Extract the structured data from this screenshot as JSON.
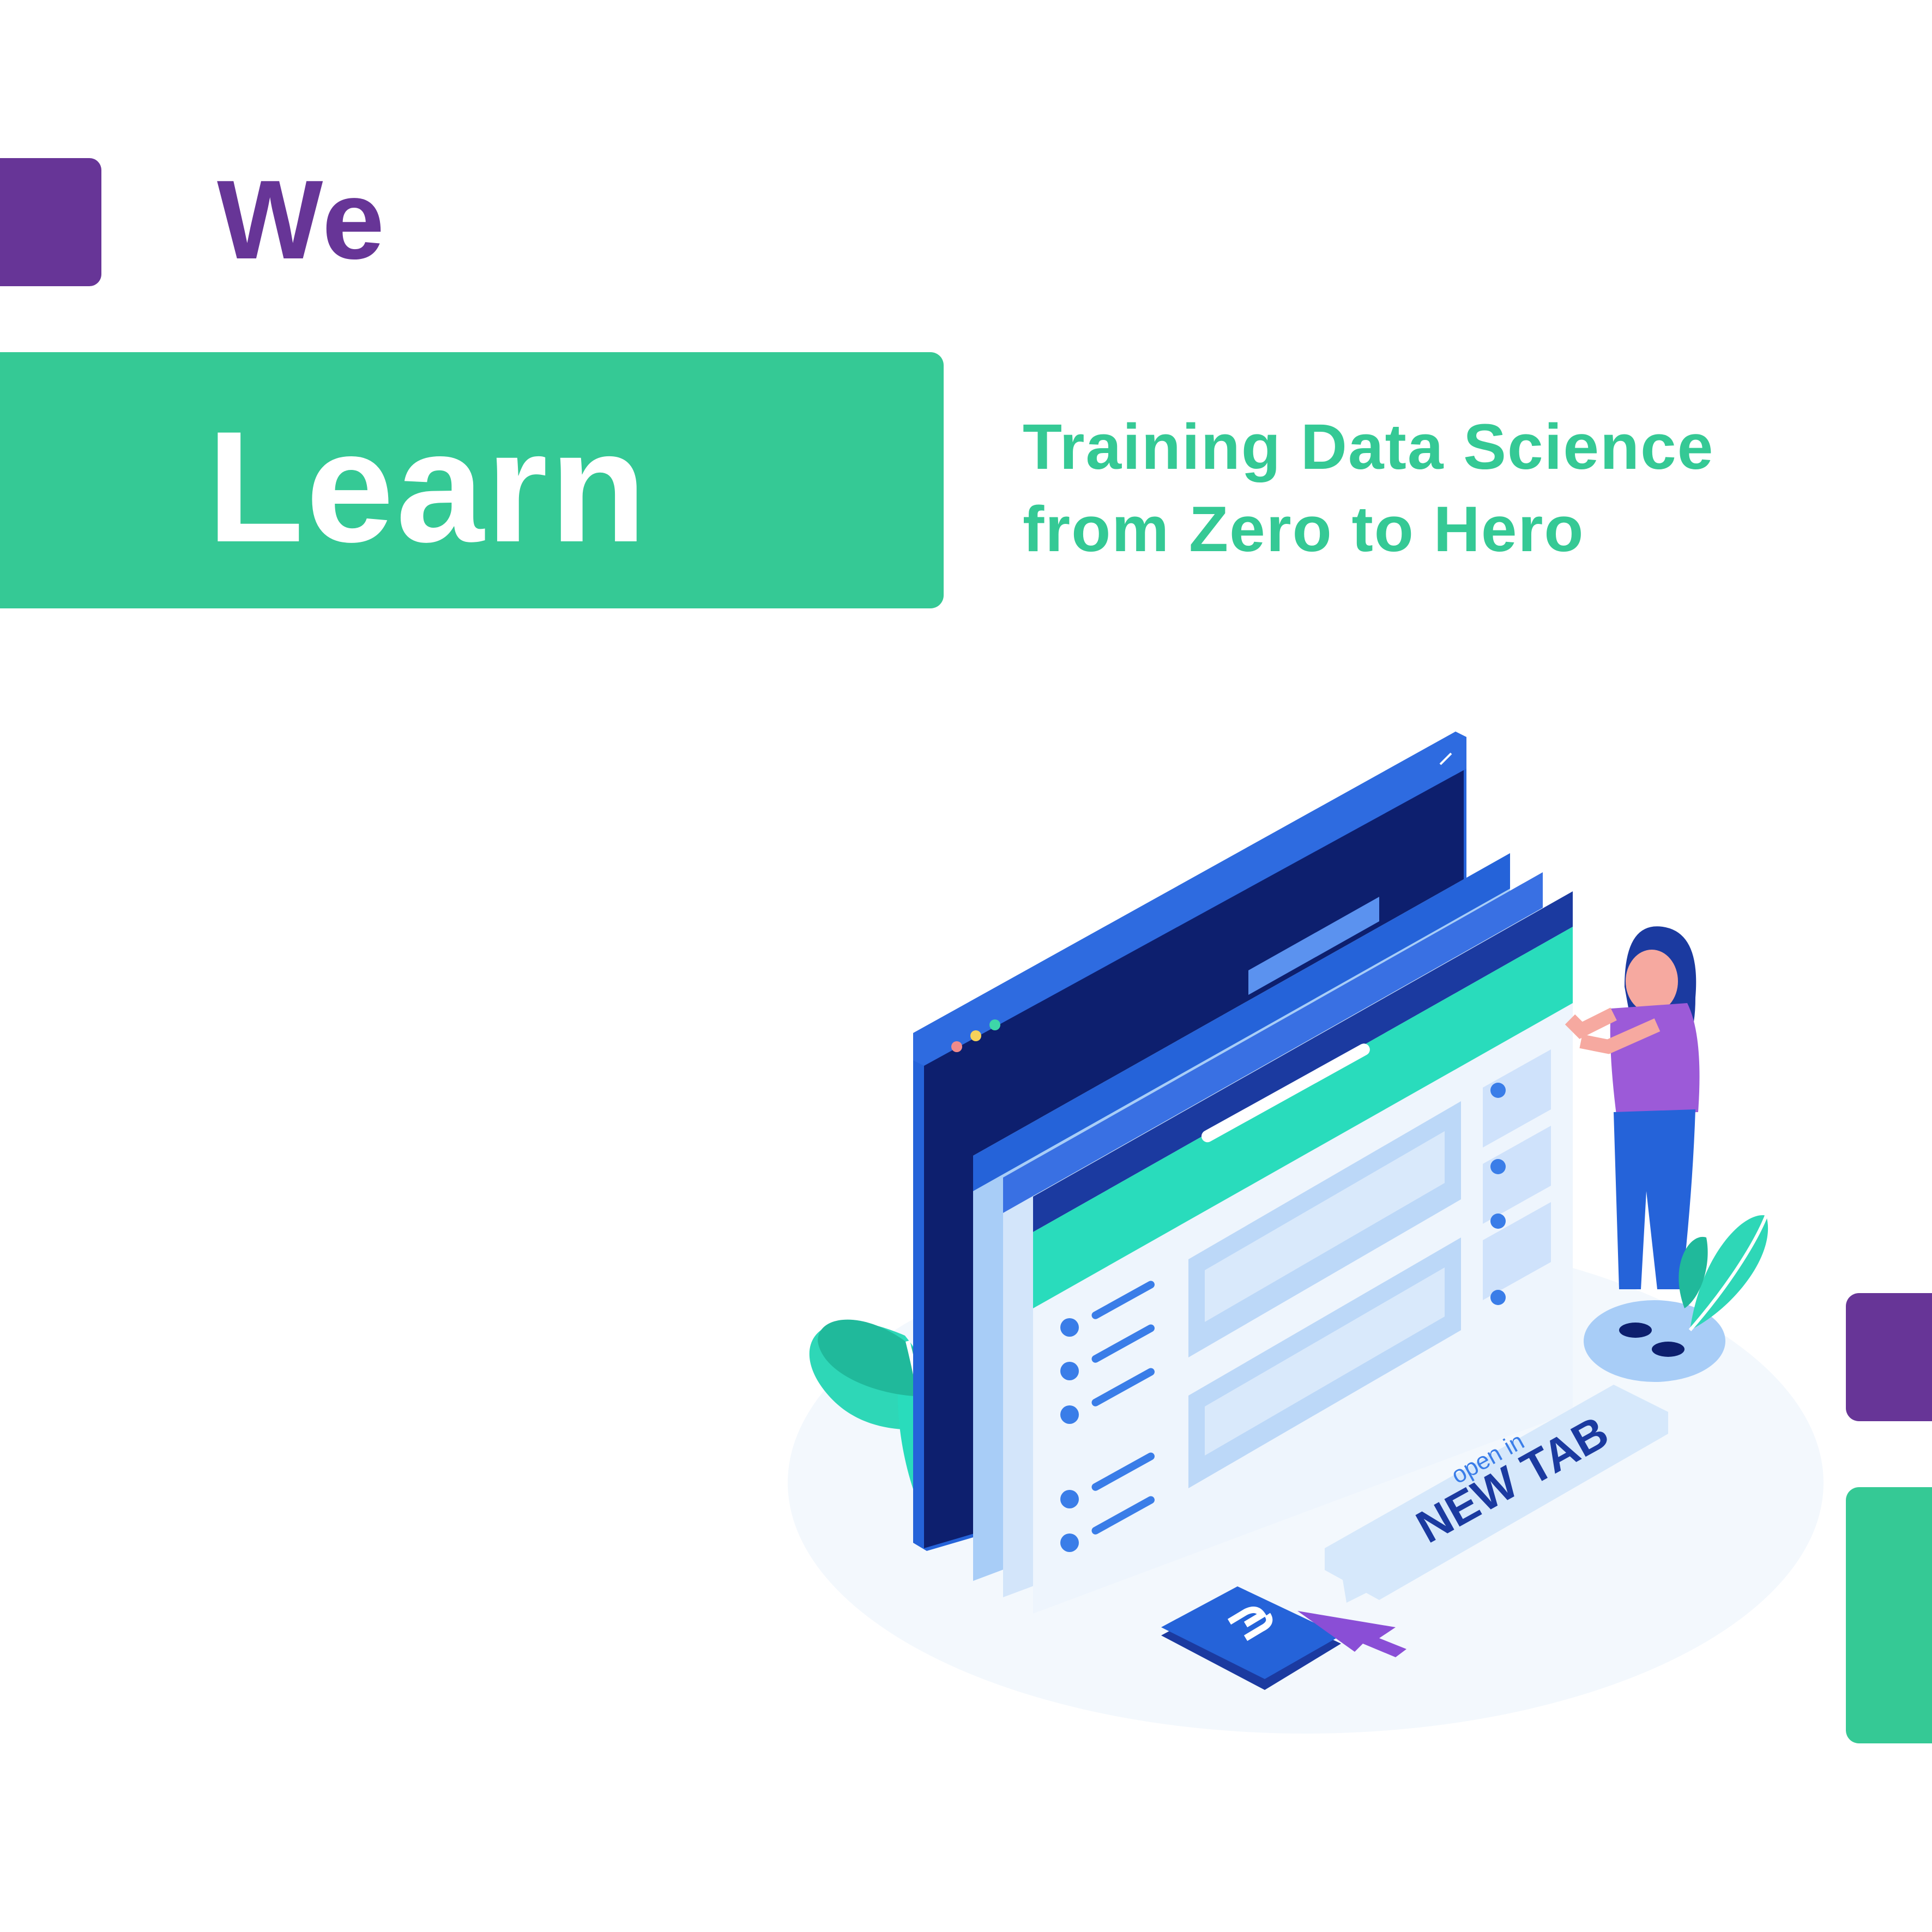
{
  "header": {
    "word_we": "We",
    "word_learn": "Learn"
  },
  "tagline": {
    "line1": "Training Data Science",
    "line2": "from Zero to Hero"
  },
  "illustration": {
    "badge_small": "open in",
    "badge_large": "NEW TAB",
    "icons": [
      "link-icon",
      "cursor-arrow-icon",
      "expand-icon",
      "close-icon",
      "back-forward-arrows-icon",
      "plant-icon",
      "woman-figure"
    ]
  },
  "colors": {
    "purple": "#673597",
    "green": "#35c995",
    "teal": "#29dcbc",
    "blue": "#2563d9",
    "navy": "#0d1f6e",
    "light_blue": "#a8cdf7"
  }
}
